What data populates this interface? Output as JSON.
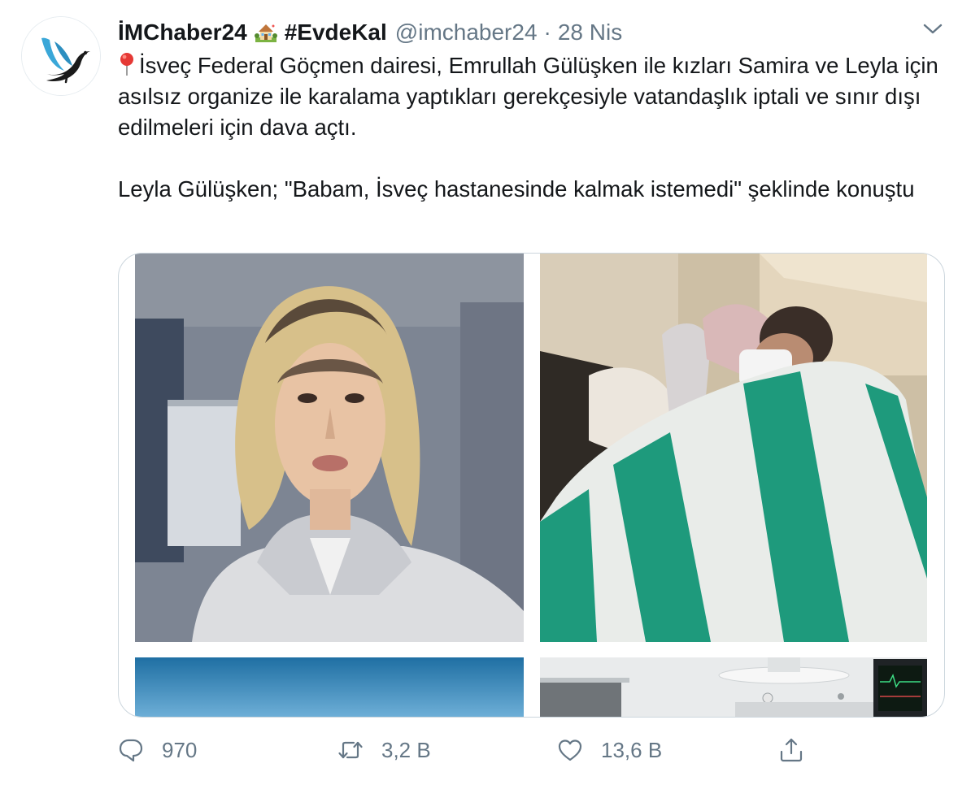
{
  "tweet": {
    "display_name": "İMChaber24",
    "house_emoji": "house-with-garden-emoji",
    "hashtag": "#EvdeKal",
    "handle": "@imchaber24",
    "separator": "·",
    "date": "28 Nis",
    "paragraph1": "İsveç Federal Göçmen dairesi, Emrullah Gülüşken ile kızları Samira ve Leyla için asılsız organize ile karalama yaptıkları gerekçesiyle vatandaşlık iptali ve sınır dışı edilmeleri için dava açtı.",
    "paragraph2": "Leyla Gülüşken; \"Babam, İsveç hastanesinde kalmak istemedi\" şeklinde konuştu"
  },
  "actions": {
    "reply_count": "970",
    "retweet_count": "3,2 B",
    "like_count": "13,6 B"
  },
  "icons": {
    "avatar": "bird-logo",
    "pin": "round-pushpin-emoji",
    "more": "chevron-down-icon",
    "reply": "reply-icon",
    "retweet": "retweet-icon",
    "like": "heart-icon",
    "share": "share-icon"
  },
  "colors": {
    "text": "#14171a",
    "secondary": "#657786",
    "border": "#ccd6dd",
    "logo_blue": "#3aa7d8"
  }
}
